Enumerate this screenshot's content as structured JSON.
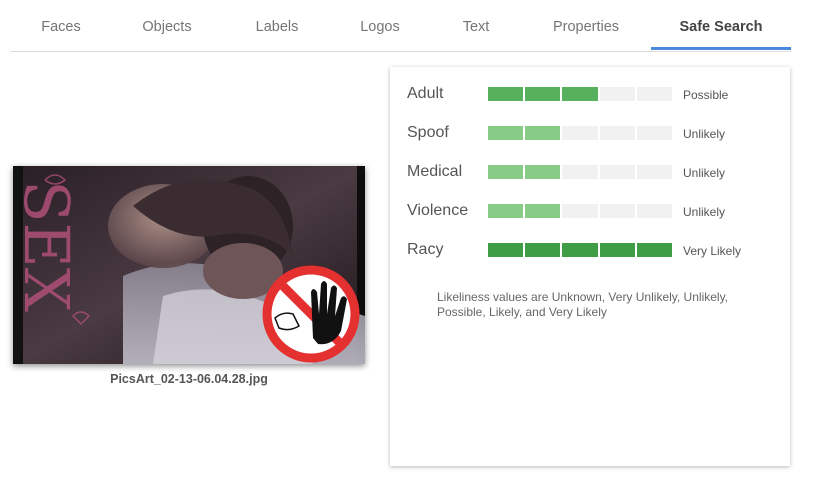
{
  "tabs": [
    {
      "label": "Faces",
      "active": false
    },
    {
      "label": "Objects",
      "active": false
    },
    {
      "label": "Labels",
      "active": false
    },
    {
      "label": "Logos",
      "active": false
    },
    {
      "label": "Text",
      "active": false
    },
    {
      "label": "Properties",
      "active": false
    },
    {
      "label": "Safe Search",
      "active": true
    }
  ],
  "image": {
    "filename": "PicsArt_02-13-06.04.28.jpg",
    "overlay_text": "SEX"
  },
  "safe_search": {
    "segments_total": 5,
    "rows": [
      {
        "label": "Adult",
        "value": "Possible",
        "filled": 3,
        "color": "#57b05b"
      },
      {
        "label": "Spoof",
        "value": "Unlikely",
        "filled": 2,
        "color": "#86cc86"
      },
      {
        "label": "Medical",
        "value": "Unlikely",
        "filled": 2,
        "color": "#86cc86"
      },
      {
        "label": "Violence",
        "value": "Unlikely",
        "filled": 2,
        "color": "#86cc86"
      },
      {
        "label": "Racy",
        "value": "Very Likely",
        "filled": 5,
        "color": "#3f9d46"
      }
    ],
    "note": "Likeliness values are Unknown, Very Unlikely, Unlikely, Possible, Likely, and Very Likely"
  },
  "colors": {
    "accent": "#4a89dc",
    "empty_segment": "#f1f1f1"
  }
}
